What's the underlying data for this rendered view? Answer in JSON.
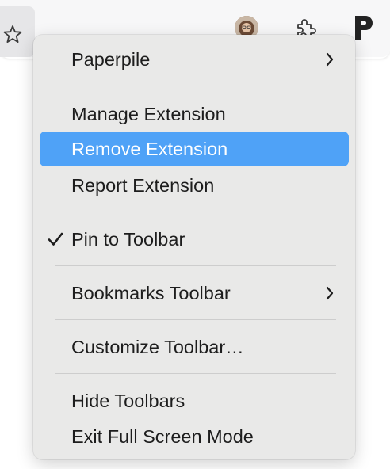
{
  "colors": {
    "menu_background": "#e9e9e8",
    "highlight": "#4fa2f7",
    "text": "#1d1d1d",
    "highlight_text": "#ffffff",
    "separator": "#cdcdcd"
  },
  "toolbar": {
    "icons": [
      "star-icon",
      "avatar",
      "puzzle-piece-icon",
      "paperpile-logo"
    ],
    "paperpile_letter": "P"
  },
  "menu": {
    "items": [
      {
        "label": "Paperpile",
        "submenu": true
      },
      {
        "label": "Manage Extension"
      },
      {
        "label": "Remove Extension",
        "highlighted": true
      },
      {
        "label": "Report Extension"
      },
      {
        "label": "Pin to Toolbar",
        "checked": true
      },
      {
        "label": "Bookmarks Toolbar",
        "submenu": true
      },
      {
        "label": "Customize Toolbar…"
      },
      {
        "label": "Hide Toolbars"
      },
      {
        "label": "Exit Full Screen Mode"
      }
    ]
  }
}
